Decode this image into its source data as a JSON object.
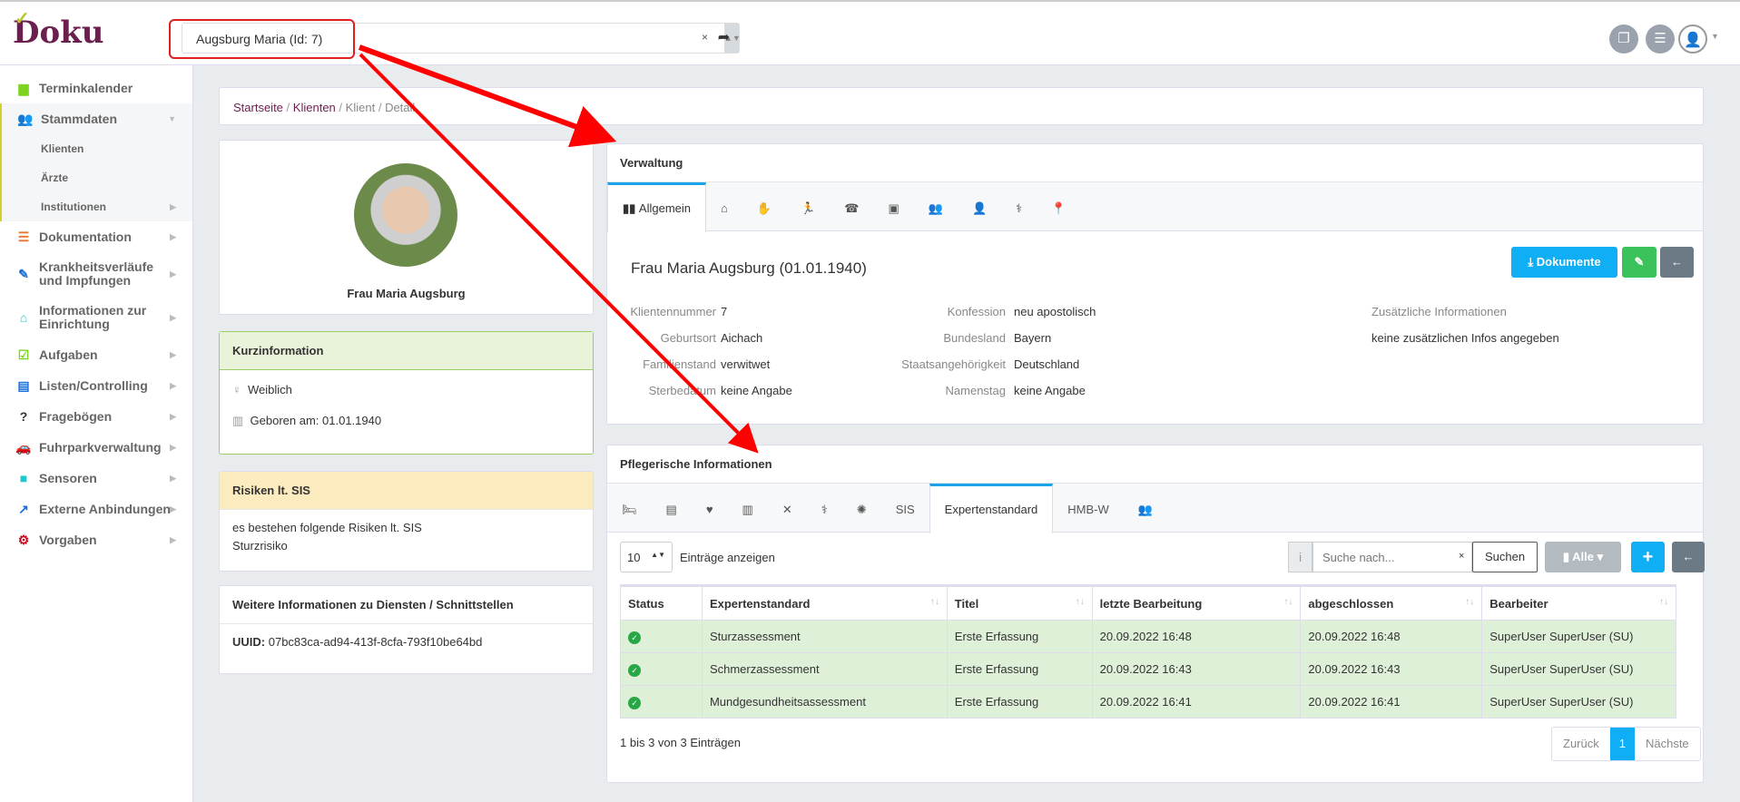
{
  "header": {
    "logo": "Doku",
    "client_select": "Augsburg Maria (Id: 7)",
    "clear": "×",
    "go_icon": "share-arrow-icon",
    "icons": [
      "windows-icon",
      "list-icon",
      "user-icon"
    ]
  },
  "sidebar": {
    "items": [
      {
        "label": "Terminkalender",
        "icon": "calendar-icon",
        "color": "#7ed321"
      },
      {
        "label": "Stammdaten",
        "icon": "users-icon",
        "color": "#d4d02a"
      },
      {
        "label": "Dokumentation",
        "icon": "list-icon",
        "color": "#e8772e"
      },
      {
        "label": "Krankheitsverläufe und Impfungen",
        "icon": "syringe-icon",
        "color": "#1a6fd8"
      },
      {
        "label": "Informationen zur Einrichtung",
        "icon": "home-icon",
        "color": "#1fc7c7"
      },
      {
        "label": "Aufgaben",
        "icon": "tasks-icon",
        "color": "#7ed321"
      },
      {
        "label": "Listen/Controlling",
        "icon": "clipboard-icon",
        "color": "#1a6fd8"
      },
      {
        "label": "Fragebögen",
        "icon": "question-icon",
        "color": "#333"
      },
      {
        "label": "Fuhrparkverwaltung",
        "icon": "car-icon",
        "color": "#e8772e"
      },
      {
        "label": "Sensoren",
        "icon": "video-icon",
        "color": "#1fc7c7"
      },
      {
        "label": "Externe Anbindungen",
        "icon": "external-link-icon",
        "color": "#1a6fd8"
      },
      {
        "label": "Vorgaben",
        "icon": "cogs-icon",
        "color": "#d0021b"
      }
    ],
    "sub": [
      "Klienten",
      "Ärzte",
      "Institutionen"
    ]
  },
  "breadcrumb": [
    "Startseite",
    "Klienten",
    "Klient",
    "Detail"
  ],
  "profile": {
    "name": "Frau Maria Augsburg"
  },
  "kurz": {
    "title": "Kurzinformation",
    "gender": "Weiblich",
    "born": "Geboren am: 01.01.1940"
  },
  "risiken": {
    "title": "Risiken lt. SIS",
    "line1": "es bestehen folgende Risiken lt. SIS",
    "line2": "Sturzrisiko"
  },
  "weitere": {
    "title": "Weitere Informationen zu Diensten / Schnittstellen",
    "uuid_label": "UUID:",
    "uuid": "07bc83ca-ad94-413f-8cfa-793f10be64bd"
  },
  "verwaltung": {
    "title": "Verwaltung",
    "tab_active": "Allgemein",
    "heading": "Frau Maria Augsburg (01.01.1940)",
    "btn_docs": "Dokumente",
    "fields": [
      [
        "Klientennummer",
        "7"
      ],
      [
        "Geburtsort",
        "Aichach"
      ],
      [
        "Familienstand",
        "verwitwet"
      ],
      [
        "Sterbedatum",
        "keine Angabe"
      ],
      [
        "Konfession",
        "neu apostolisch"
      ],
      [
        "Bundesland",
        "Bayern"
      ],
      [
        "Staatsangehörigkeit",
        "Deutschland"
      ],
      [
        "Namenstag",
        "keine Angabe"
      ]
    ],
    "extra_label": "Zusätzliche Informationen",
    "extra_value": "keine zusätzlichen Infos angegeben"
  },
  "pflege": {
    "title": "Pflegerische Informationen",
    "tabs": [
      "SIS",
      "Expertenstandard",
      "HMB-W"
    ],
    "entries": "10",
    "entries_label": "Einträge anzeigen",
    "search_placeholder": "Suche nach...",
    "search_btn": "Suchen",
    "filter": "Alle",
    "columns": [
      "Status",
      "Expertenstandard",
      "Titel",
      "letzte Bearbeitung",
      "abgeschlossen",
      "Bearbeiter"
    ],
    "rows": [
      [
        "Sturzassessment",
        "Erste Erfassung",
        "20.09.2022 16:48",
        "20.09.2022 16:48",
        "SuperUser SuperUser (SU)"
      ],
      [
        "Schmerzassessment",
        "Erste Erfassung",
        "20.09.2022 16:43",
        "20.09.2022 16:43",
        "SuperUser SuperUser (SU)"
      ],
      [
        "Mundgesundheitsassessment",
        "Erste Erfassung",
        "20.09.2022 16:41",
        "20.09.2022 16:41",
        "SuperUser SuperUser (SU)"
      ]
    ],
    "info": "1 bis 3 von 3 Einträgen",
    "prev": "Zurück",
    "page": "1",
    "next": "Nächste"
  }
}
